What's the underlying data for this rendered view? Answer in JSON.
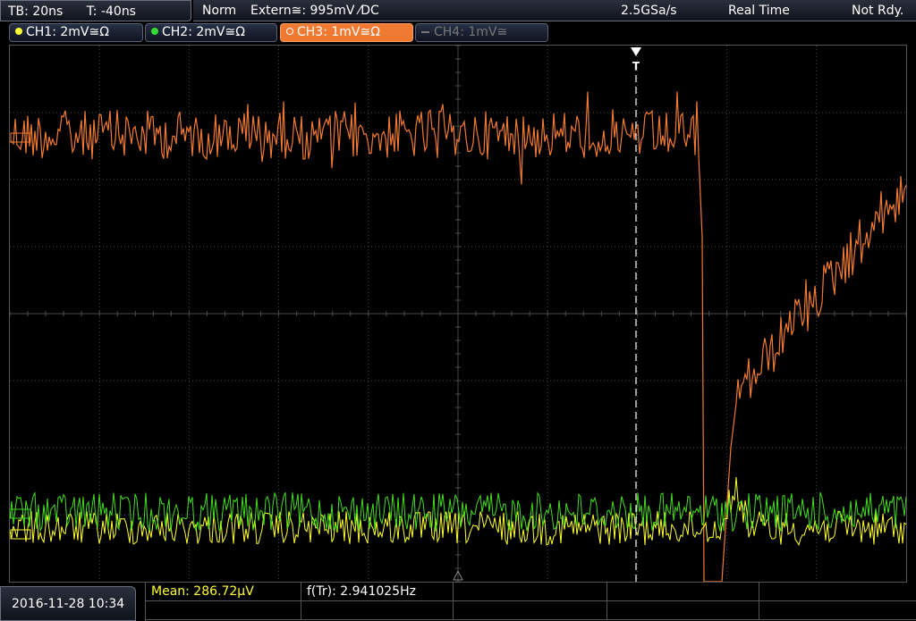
{
  "status": {
    "timebase": "TB: 20ns",
    "time_offset": "T: -40ns",
    "trigger_mode": "Norm",
    "trigger_source": "Extern≅: 995mV ⁄DC",
    "sample_rate": "2.5GSa/s",
    "acq_mode": "Real Time",
    "ready_state": "Not Rdy."
  },
  "channels": [
    {
      "label": "CH1: 2mV≅Ω",
      "color": "#ffff33",
      "active": true
    },
    {
      "label": "CH2: 2mV≅Ω",
      "color": "#33dd33",
      "active": true
    },
    {
      "label": "CH3: 1mV≅Ω",
      "color": "#f07a32",
      "active": true,
      "selected": true
    },
    {
      "label": "CH4: 1mV≅",
      "color": "#777777",
      "active": false
    }
  ],
  "trigger_marker": "T",
  "datetime": "2016-11-28 10:34",
  "measurements": {
    "mean": "Mean: 286.72µV",
    "freq": "f(Tr): 2.941025Hz"
  },
  "colors": {
    "ch1": "#ffff33",
    "ch2": "#44dd22",
    "ch3": "#f07a32",
    "grid": "#4a4a4a"
  }
}
